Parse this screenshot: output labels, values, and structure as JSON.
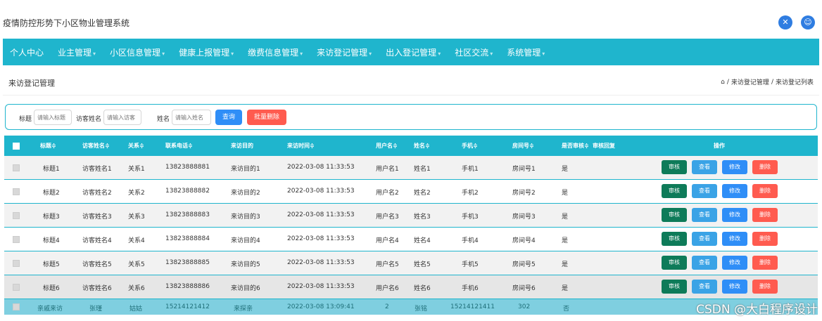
{
  "app": {
    "title": "疫情防控形势下小区物业管理系统"
  },
  "nav": [
    {
      "label": "个人中心",
      "caret": false
    },
    {
      "label": "业主管理",
      "caret": true
    },
    {
      "label": "小区信息管理",
      "caret": true
    },
    {
      "label": "健康上报管理",
      "caret": true
    },
    {
      "label": "缴费信息管理",
      "caret": true
    },
    {
      "label": "来访登记管理",
      "caret": true
    },
    {
      "label": "出入登记管理",
      "caret": true
    },
    {
      "label": "社区交流",
      "caret": true
    },
    {
      "label": "系统管理",
      "caret": true
    }
  ],
  "page": {
    "title": "来访登记管理",
    "breadcrumb": [
      "来访登记管理",
      "来访登记列表"
    ],
    "sep": "/"
  },
  "search": {
    "title_label": "标题",
    "title_placeholder": "请输入标题",
    "visitor_label": "访客姓名",
    "visitor_placeholder": "请输入访客",
    "name_label": "姓名",
    "name_placeholder": "请输入姓名",
    "query_label": "查询",
    "batch_delete_label": "批量删除"
  },
  "table": {
    "headers": [
      "标题≑",
      "访客姓名≑",
      "关系≑",
      "联系电话≑",
      "来访目的",
      "来访时间≑",
      "用户名≑",
      "姓名≑",
      "手机≑",
      "房间号≑",
      "是否审核≑",
      "审核回复",
      "操作"
    ],
    "actions": {
      "audit": "审核",
      "view": "查看",
      "edit": "修改",
      "delete": "删除"
    },
    "rows": [
      [
        "标题1",
        "访客姓名1",
        "关系1",
        "13823888881",
        "来访目的1",
        "2022-03-08 11:33:53",
        "用户名1",
        "姓名1",
        "手机1",
        "房间号1",
        "是",
        ""
      ],
      [
        "标题2",
        "访客姓名2",
        "关系2",
        "13823888882",
        "来访目的2",
        "2022-03-08 11:33:53",
        "用户名2",
        "姓名2",
        "手机2",
        "房间号2",
        "是",
        ""
      ],
      [
        "标题3",
        "访客姓名3",
        "关系3",
        "13823888883",
        "来访目的3",
        "2022-03-08 11:33:53",
        "用户名3",
        "姓名3",
        "手机3",
        "房间号3",
        "是",
        ""
      ],
      [
        "标题4",
        "访客姓名4",
        "关系4",
        "13823888884",
        "来访目的4",
        "2022-03-08 11:33:53",
        "用户名4",
        "姓名4",
        "手机4",
        "房间号4",
        "是",
        ""
      ],
      [
        "标题5",
        "访客姓名5",
        "关系5",
        "13823888885",
        "来访目的5",
        "2022-03-08 11:33:53",
        "用户名5",
        "姓名5",
        "手机5",
        "房间号5",
        "是",
        ""
      ],
      [
        "标题6",
        "访客姓名6",
        "关系6",
        "13823888886",
        "来访目的6",
        "2022-03-08 11:33:53",
        "用户名6",
        "姓名6",
        "手机6",
        "房间号6",
        "是",
        ""
      ]
    ],
    "partial_row": [
      "亲戚来访",
      "张瑾",
      "姑姑",
      "15214121412",
      "来探亲",
      "2022-03-08 13:09:41",
      "2",
      "张铭",
      "15214121411",
      "302",
      "否",
      ""
    ]
  },
  "watermark": "CSDN @大白程序设计"
}
